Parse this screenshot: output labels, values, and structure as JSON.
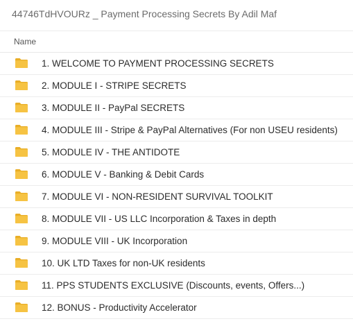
{
  "breadcrumb": "44746TdHVOURz _ Payment Processing Secrets By Adil Maf",
  "columns": {
    "name": "Name"
  },
  "colors": {
    "folder": "#f6c343",
    "folder_dark": "#e9ae27"
  },
  "icons": {
    "folder": "folder-icon"
  },
  "items": [
    {
      "label": "1. WELCOME TO PAYMENT PROCESSING SECRETS"
    },
    {
      "label": "2. MODULE I - STRIPE SECRETS"
    },
    {
      "label": "3. MODULE II - PayPal SECRETS"
    },
    {
      "label": "4. MODULE III - Stripe & PayPal Alternatives (For non USEU residents)"
    },
    {
      "label": "5. MODULE IV - THE ANTIDOTE"
    },
    {
      "label": "6. MODULE V - Banking & Debit Cards"
    },
    {
      "label": "7. MODULE VI - NON-RESIDENT SURVIVAL TOOLKIT"
    },
    {
      "label": "8. MODULE VII - US LLC Incorporation & Taxes in depth"
    },
    {
      "label": "9. MODULE VIII - UK Incorporation"
    },
    {
      "label": "10. UK LTD Taxes for non-UK residents"
    },
    {
      "label": "11. PPS STUDENTS EXCLUSIVE (Discounts, events, Offers...)"
    },
    {
      "label": "12. BONUS - Productivity Accelerator"
    }
  ]
}
